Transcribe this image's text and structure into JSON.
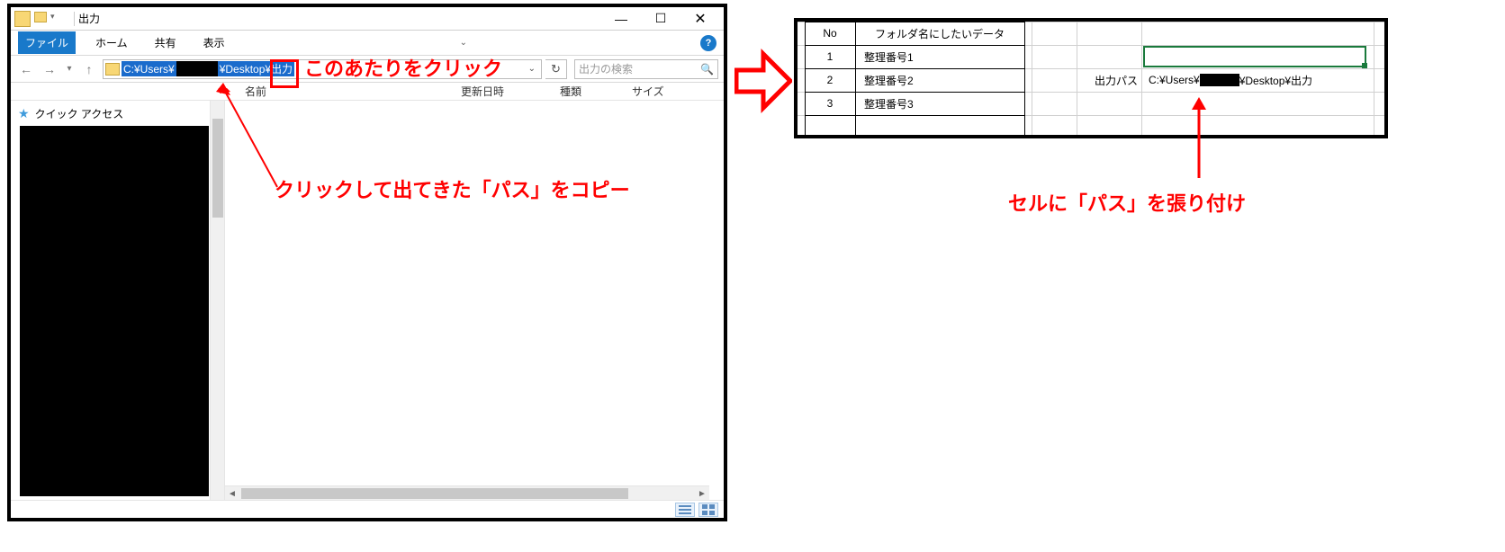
{
  "explorer": {
    "title": "出力",
    "ribbon": {
      "file": "ファイル",
      "home": "ホーム",
      "share": "共有",
      "view": "表示"
    },
    "address": {
      "seg1": "C:¥Users¥",
      "seg2": "¥Desktop¥出力"
    },
    "search_placeholder": "出力の検索",
    "columns": {
      "name": "名前",
      "date": "更新日時",
      "type": "種類",
      "size": "サイズ"
    },
    "sidebar": {
      "quick_access": "クイック アクセス"
    }
  },
  "excel": {
    "headers": {
      "no": "No",
      "data": "フォルダ名にしたいデータ"
    },
    "rows": [
      {
        "no": "1",
        "data": "整理番号1"
      },
      {
        "no": "2",
        "data": "整理番号2"
      },
      {
        "no": "3",
        "data": "整理番号3"
      }
    ],
    "path_label": "出力パス",
    "path_value_a": "C:¥Users¥",
    "path_value_b": "¥Desktop¥出力"
  },
  "annotations": {
    "click_here": "このあたりをクリック",
    "copy_path": "クリックして出てきた「パス」をコピー",
    "paste_path": "セルに「パス」を張り付け"
  }
}
